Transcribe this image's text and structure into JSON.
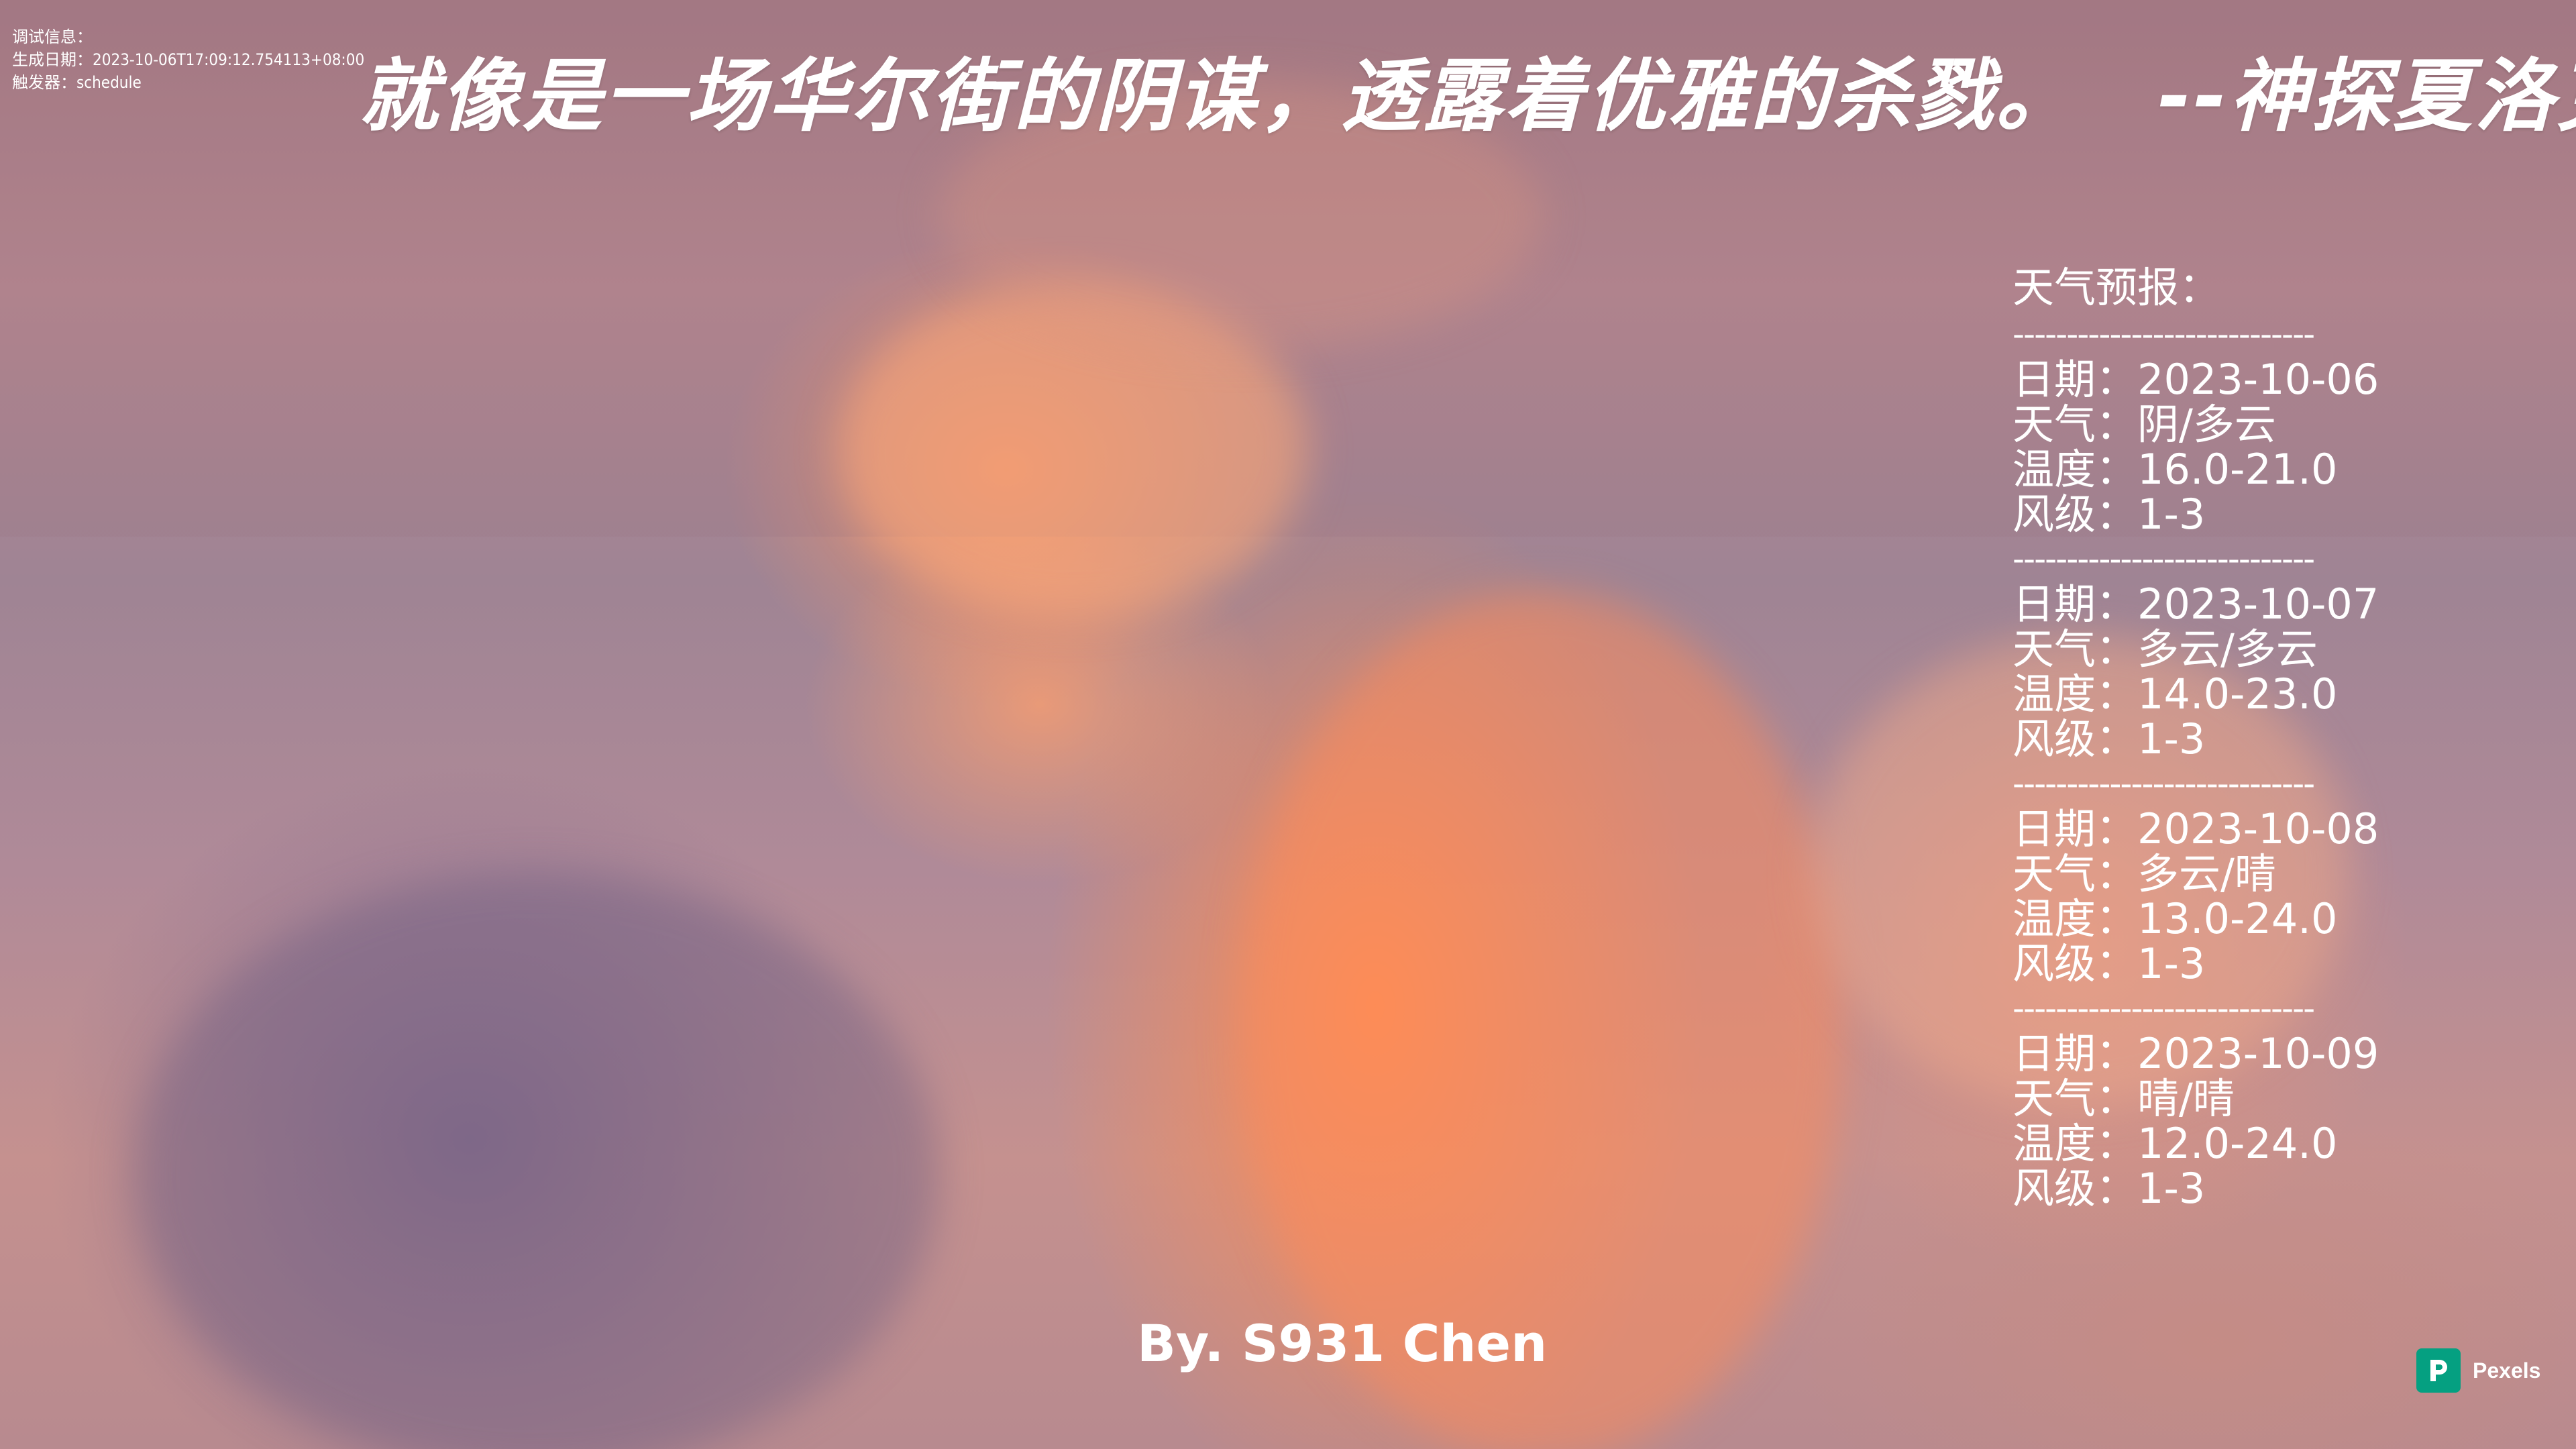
{
  "debug": {
    "line1": "调试信息：",
    "line2": "生成日期：2023-10-06T17:09:12.754113+08:00",
    "line3": "触发器：schedule"
  },
  "quote": {
    "text": "就像是一场华尔街的阴谋，透露着优雅的杀戮。",
    "author": "--神探夏洛克"
  },
  "weather": {
    "title": "天气预报：",
    "separator": "----------------------------",
    "days": [
      {
        "date": "日期：2023-10-06",
        "weather": "天气：阴/多云",
        "temp": "温度：16.0-21.0",
        "wind": "风级：1-3"
      },
      {
        "date": "日期：2023-10-07",
        "weather": "天气：多云/多云",
        "temp": "温度：14.0-23.0",
        "wind": "风级：1-3"
      },
      {
        "date": "日期：2023-10-08",
        "weather": "天气：多云/晴",
        "temp": "温度：13.0-24.0",
        "wind": "风级：1-3"
      },
      {
        "date": "日期：2023-10-09",
        "weather": "天气：晴/晴",
        "temp": "温度：12.0-24.0",
        "wind": "风级：1-3"
      }
    ]
  },
  "byline": "By. S931 Chen",
  "watermark": {
    "label": "Pexels",
    "icon": "pexels-logo-icon",
    "color": "#05a081"
  }
}
